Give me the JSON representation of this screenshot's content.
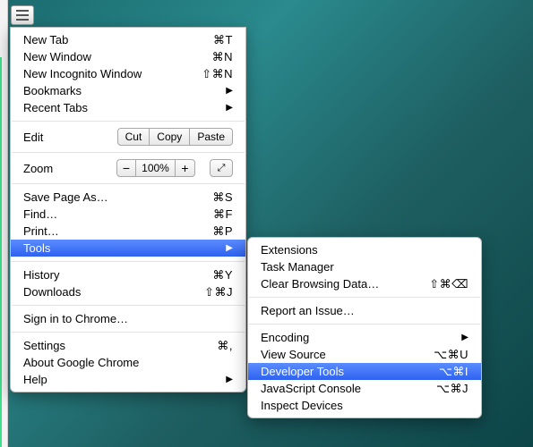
{
  "main_menu": {
    "new_tab": {
      "label": "New Tab",
      "shortcut": "⌘T"
    },
    "new_window": {
      "label": "New Window",
      "shortcut": "⌘N"
    },
    "new_incognito": {
      "label": "New Incognito Window",
      "shortcut": "⇧⌘N"
    },
    "bookmarks": {
      "label": "Bookmarks"
    },
    "recent_tabs": {
      "label": "Recent Tabs"
    },
    "edit": {
      "label": "Edit",
      "cut": "Cut",
      "copy": "Copy",
      "paste": "Paste"
    },
    "zoom": {
      "label": "Zoom",
      "minus": "−",
      "value": "100%",
      "plus": "+"
    },
    "save_page": {
      "label": "Save Page As…",
      "shortcut": "⌘S"
    },
    "find": {
      "label": "Find…",
      "shortcut": "⌘F"
    },
    "print": {
      "label": "Print…",
      "shortcut": "⌘P"
    },
    "tools": {
      "label": "Tools"
    },
    "history": {
      "label": "History",
      "shortcut": "⌘Y"
    },
    "downloads": {
      "label": "Downloads",
      "shortcut": "⇧⌘J"
    },
    "signin": {
      "label": "Sign in to Chrome…"
    },
    "settings": {
      "label": "Settings",
      "shortcut": "⌘,"
    },
    "about": {
      "label": "About Google Chrome"
    },
    "help": {
      "label": "Help"
    }
  },
  "submenu": {
    "extensions": {
      "label": "Extensions"
    },
    "task_manager": {
      "label": "Task Manager"
    },
    "clear_data": {
      "label": "Clear Browsing Data…",
      "shortcut": "⇧⌘⌫"
    },
    "report": {
      "label": "Report an Issue…"
    },
    "encoding": {
      "label": "Encoding"
    },
    "view_source": {
      "label": "View Source",
      "shortcut": "⌥⌘U"
    },
    "dev_tools": {
      "label": "Developer Tools",
      "shortcut": "⌥⌘I"
    },
    "js_console": {
      "label": "JavaScript Console",
      "shortcut": "⌥⌘J"
    },
    "inspect_devices": {
      "label": "Inspect Devices"
    }
  }
}
